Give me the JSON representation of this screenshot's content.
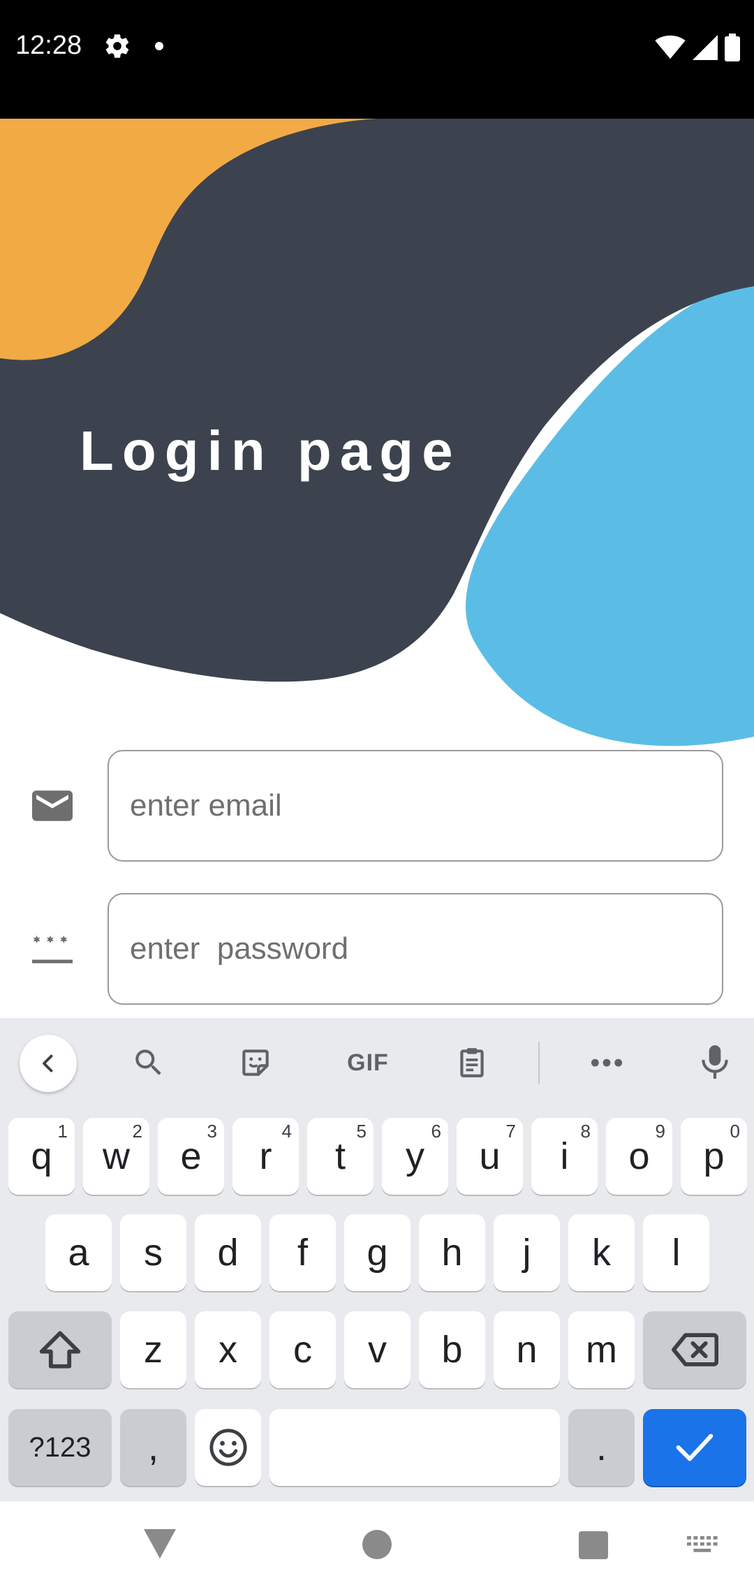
{
  "status_bar": {
    "time": "12:28",
    "icons": [
      "gear-icon",
      "notification-dot",
      "wifi-icon",
      "signal-icon",
      "battery-icon"
    ]
  },
  "header": {
    "title": "Login page",
    "colors": {
      "dark": "#3c434e",
      "orange": "#f2aa45",
      "blue": "#5bbde6"
    }
  },
  "form": {
    "email": {
      "icon": "mail-icon",
      "placeholder": "enter email",
      "value": ""
    },
    "password": {
      "icon": "password-icon",
      "placeholder": "enter  password",
      "value": ""
    }
  },
  "keyboard": {
    "toolbar": [
      "back-icon",
      "search-icon",
      "sticker-icon",
      "GIF",
      "clipboard-icon",
      "more-icon",
      "mic-icon"
    ],
    "gif_label": "GIF",
    "row1": [
      {
        "k": "q",
        "h": "1"
      },
      {
        "k": "w",
        "h": "2"
      },
      {
        "k": "e",
        "h": "3"
      },
      {
        "k": "r",
        "h": "4"
      },
      {
        "k": "t",
        "h": "5"
      },
      {
        "k": "y",
        "h": "6"
      },
      {
        "k": "u",
        "h": "7"
      },
      {
        "k": "i",
        "h": "8"
      },
      {
        "k": "o",
        "h": "9"
      },
      {
        "k": "p",
        "h": "0"
      }
    ],
    "row2": [
      "a",
      "s",
      "d",
      "f",
      "g",
      "h",
      "j",
      "k",
      "l"
    ],
    "row3": [
      "z",
      "x",
      "c",
      "v",
      "b",
      "n",
      "m"
    ],
    "row4": {
      "symbols": "?123",
      "comma": ",",
      "period": "."
    },
    "accent": "#1a73e8"
  },
  "nav_bar": [
    "back-triangle-icon",
    "home-circle-icon",
    "recents-square-icon",
    "keyboard-switch-icon"
  ]
}
